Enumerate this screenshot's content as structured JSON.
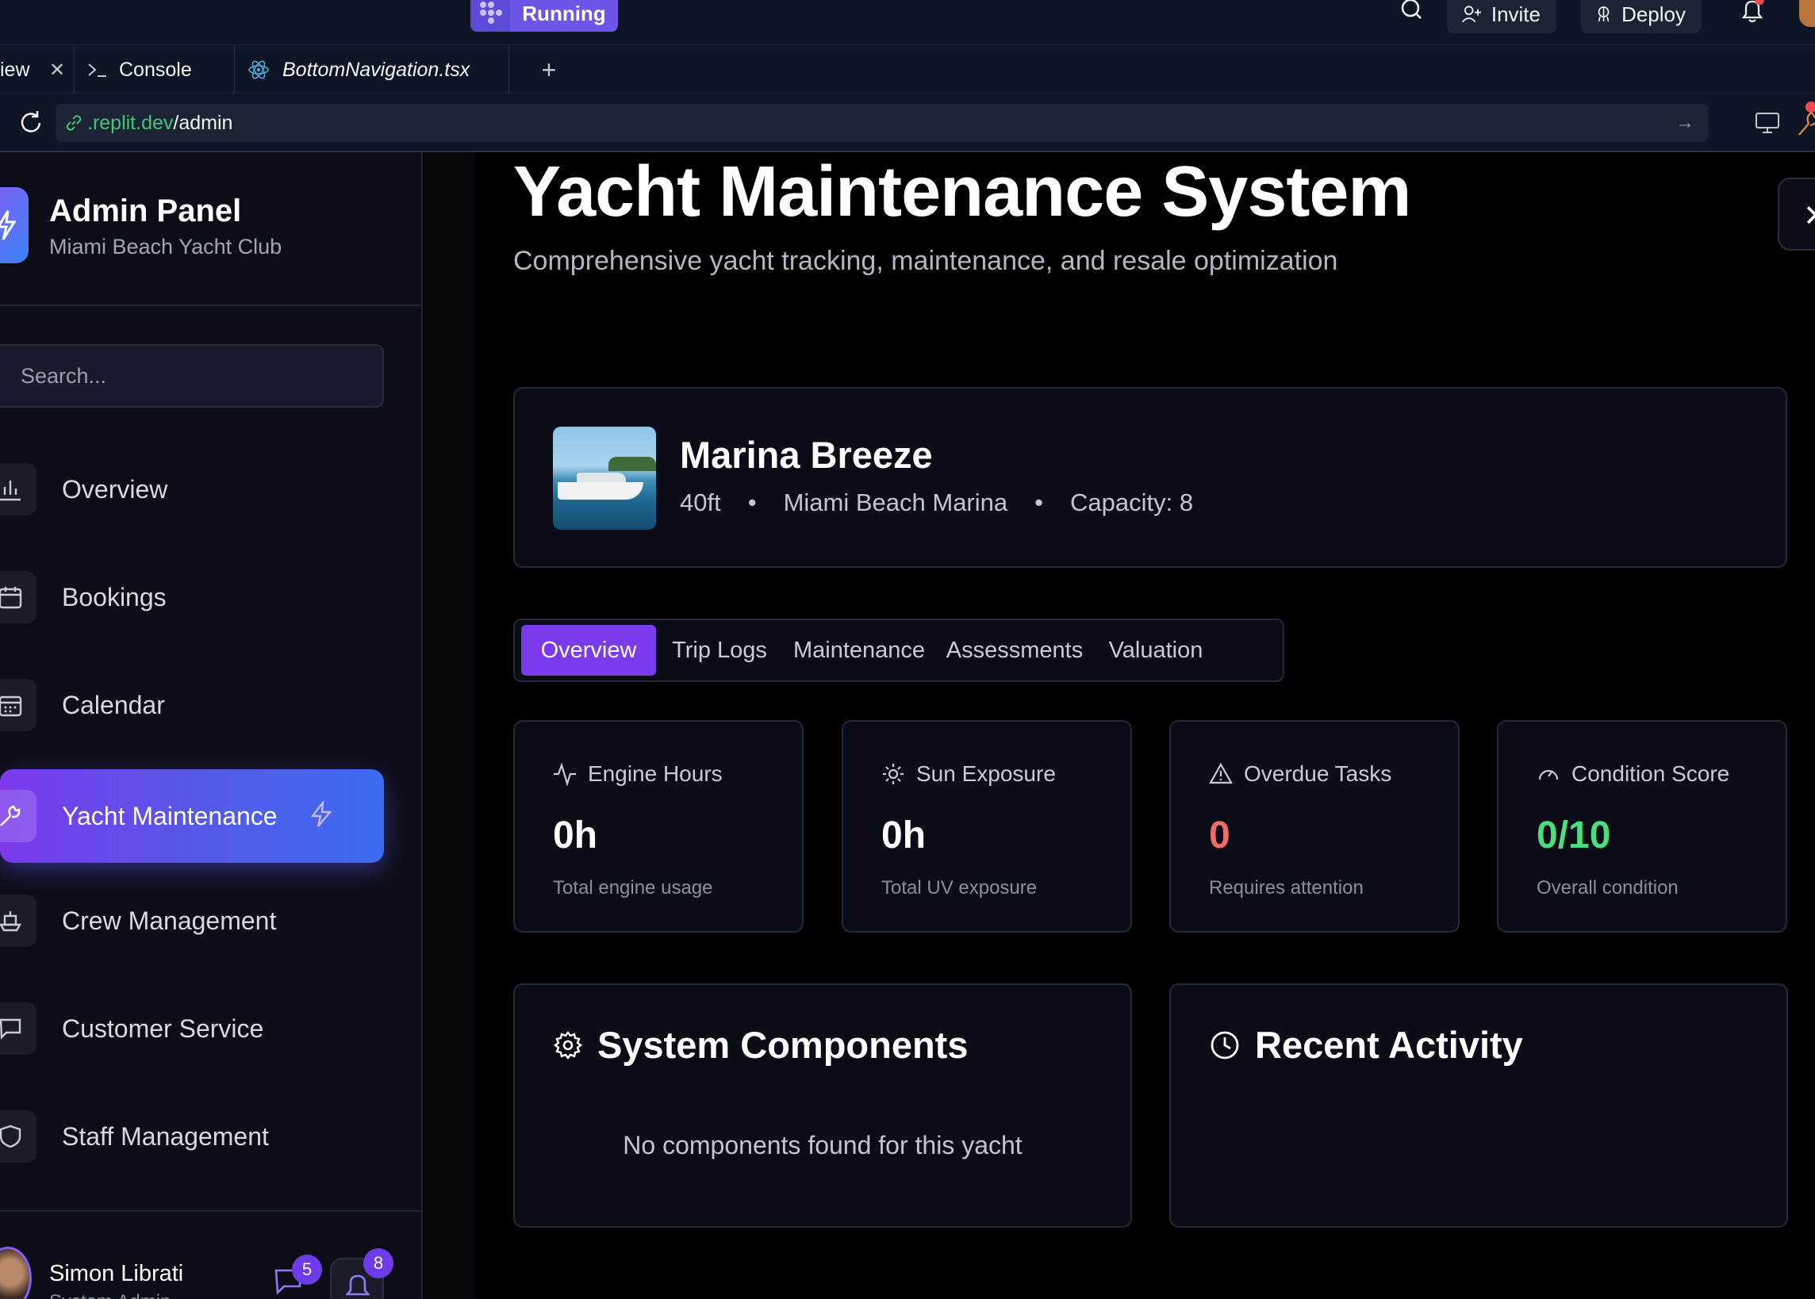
{
  "ide": {
    "run_label": "Running",
    "invite_label": "Invite",
    "deploy_label": "Deploy",
    "tabs": {
      "preview": "iew",
      "console": "Console",
      "file": "BottomNavigation.tsx"
    },
    "url": {
      "host": ".replit.dev",
      "path": "/admin"
    }
  },
  "sidebar": {
    "title": "Admin Panel",
    "subtitle": "Miami Beach Yacht Club",
    "search_placeholder": "Search...",
    "items": [
      {
        "label": "Overview",
        "icon": "bar-chart-icon"
      },
      {
        "label": "Bookings",
        "icon": "calendar-icon"
      },
      {
        "label": "Calendar",
        "icon": "calendar-grid-icon"
      },
      {
        "label": "Yacht Maintenance",
        "icon": "wrench-icon",
        "active": true
      },
      {
        "label": "Crew Management",
        "icon": "ship-icon"
      },
      {
        "label": "Customer Service",
        "icon": "message-icon"
      },
      {
        "label": "Staff Management",
        "icon": "shield-icon"
      }
    ],
    "user": {
      "name": "Simon Librati",
      "role": "System Admin"
    },
    "message_count": "5",
    "notification_count": "8"
  },
  "main": {
    "title": "Yacht Maintenance System",
    "subtitle": "Comprehensive yacht tracking, maintenance, and resale optimization",
    "yacht": {
      "name": "Marina Breeze",
      "length": "40ft",
      "location": "Miami Beach Marina",
      "capacity": "Capacity: 8"
    },
    "tabs": [
      "Overview",
      "Trip Logs",
      "Maintenance",
      "Assessments",
      "Valuation"
    ],
    "active_tab": "Overview",
    "stats": [
      {
        "label": "Engine Hours",
        "value": "0h",
        "desc": "Total engine usage",
        "color": "#ffffff"
      },
      {
        "label": "Sun Exposure",
        "value": "0h",
        "desc": "Total UV exposure",
        "color": "#ffffff"
      },
      {
        "label": "Overdue Tasks",
        "value": "0",
        "desc": "Requires attention",
        "color": "#f26b6b"
      },
      {
        "label": "Condition Score",
        "value": "0/10",
        "desc": "Overall condition",
        "color": "#4ade80"
      }
    ],
    "components": {
      "title": "System Components",
      "empty": "No components found for this yacht"
    },
    "activity": {
      "title": "Recent Activity"
    }
  },
  "colors": {
    "accent": "#7c3aed",
    "accent_blue": "#3b6cf0",
    "danger": "#f26b6b",
    "success": "#4ade80"
  }
}
